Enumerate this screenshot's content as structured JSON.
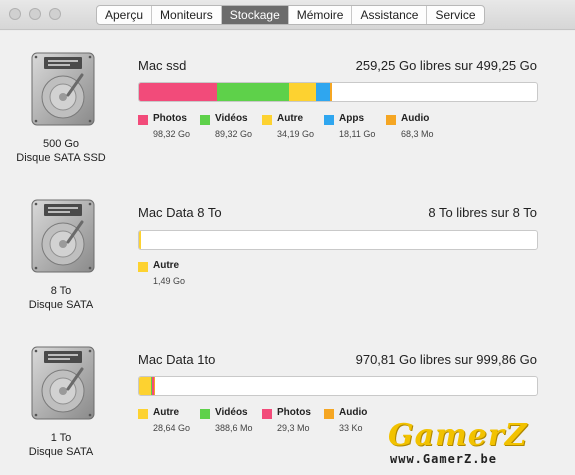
{
  "window": {
    "tabs": [
      {
        "label": "Aperçu"
      },
      {
        "label": "Moniteurs"
      },
      {
        "label": "Stockage",
        "active": true
      },
      {
        "label": "Mémoire"
      },
      {
        "label": "Assistance"
      },
      {
        "label": "Service"
      }
    ]
  },
  "colors": {
    "photos": "#f24b7a",
    "videos": "#5ed14a",
    "autre": "#fdd230",
    "apps": "#2fa6ef",
    "audio": "#f5a623"
  },
  "disks": [
    {
      "capacity": "500 Go",
      "type": "Disque SATA SSD",
      "name": "Mac ssd",
      "free_text": "259,25 Go libres sur 499,25 Go",
      "segments": [
        {
          "category": "photos",
          "fraction": 0.197
        },
        {
          "category": "videos",
          "fraction": 0.179
        },
        {
          "category": "autre",
          "fraction": 0.068
        },
        {
          "category": "apps",
          "fraction": 0.036
        },
        {
          "category": "audio",
          "fraction": 0.0001
        }
      ],
      "legend": [
        {
          "category": "photos",
          "label": "Photos",
          "size": "98,32 Go"
        },
        {
          "category": "videos",
          "label": "Vidéos",
          "size": "89,32 Go"
        },
        {
          "category": "autre",
          "label": "Autre",
          "size": "34,19 Go"
        },
        {
          "category": "apps",
          "label": "Apps",
          "size": "18,11 Go"
        },
        {
          "category": "audio",
          "label": "Audio",
          "size": "68,3 Mo"
        }
      ]
    },
    {
      "capacity": "8 To",
      "type": "Disque SATA",
      "name": "Mac Data 8 To",
      "free_text": "8 To libres sur 8 To",
      "segments": [
        {
          "category": "autre",
          "fraction": 0.0002
        }
      ],
      "legend": [
        {
          "category": "autre",
          "label": "Autre",
          "size": "1,49 Go"
        }
      ]
    },
    {
      "capacity": "1 To",
      "type": "Disque SATA",
      "name": "Mac Data 1to",
      "free_text": "970,81 Go libres sur 999,86 Go",
      "segments": [
        {
          "category": "autre",
          "fraction": 0.029
        },
        {
          "category": "videos",
          "fraction": 0.0004
        },
        {
          "category": "photos",
          "fraction": 0.0001
        },
        {
          "category": "audio",
          "fraction": 3e-05
        }
      ],
      "legend": [
        {
          "category": "autre",
          "label": "Autre",
          "size": "28,64 Go"
        },
        {
          "category": "videos",
          "label": "Vidéos",
          "size": "388,6 Mo"
        },
        {
          "category": "photos",
          "label": "Photos",
          "size": "29,3 Mo"
        },
        {
          "category": "audio",
          "label": "Audio",
          "size": "33 Ko"
        }
      ]
    }
  ],
  "watermark": {
    "logo_text": "GamerZ",
    "url": "www.GamerZ.be"
  }
}
